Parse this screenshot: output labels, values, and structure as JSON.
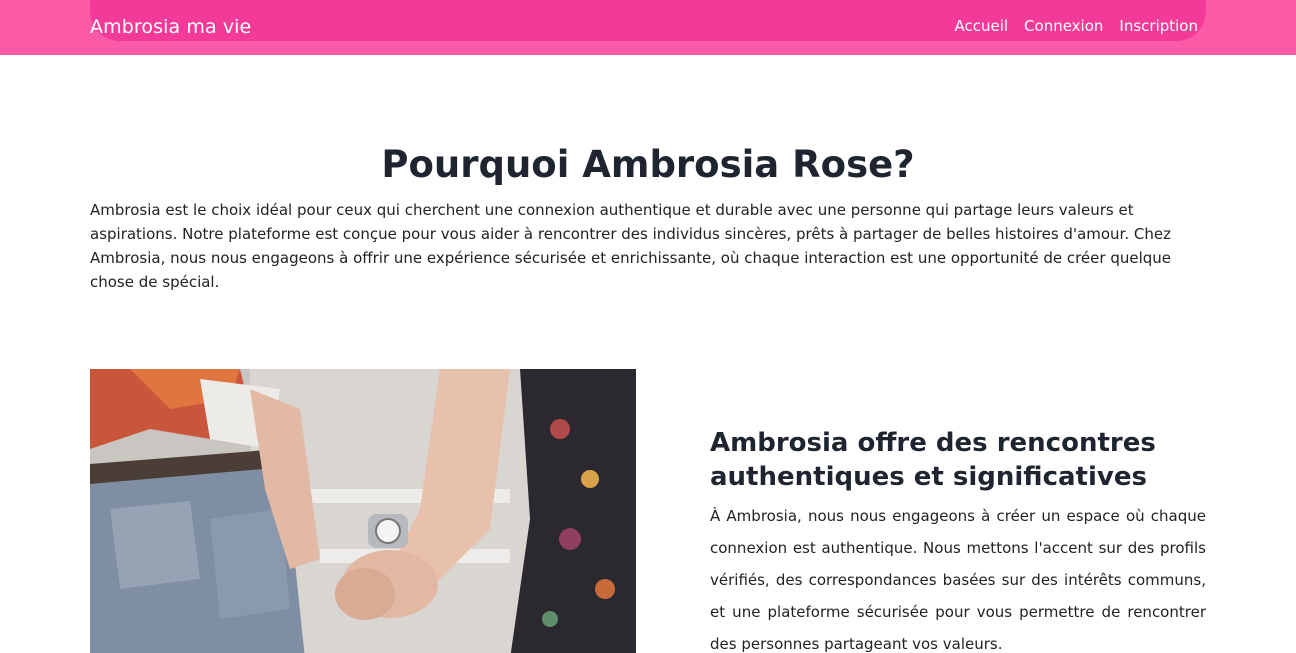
{
  "navbar": {
    "brand": "Ambrosia ma vie",
    "links": [
      "Accueil",
      "Connexion",
      "Inscription"
    ]
  },
  "why": {
    "title": "Pourquoi Ambrosia Rose?",
    "text": "Ambrosia est le choix idéal pour ceux qui cherchent une connexion authentique et durable avec une personne qui partage leurs valeurs et aspirations. Notre plateforme est conçue pour vous aider à rencontrer des individus sincères, prêts à partager de belles histoires d'amour. Chez Ambrosia, nous nous engageons à offrir une expérience sécurisée et enrichissante, où chaque interaction est une opportunité de créer quelque chose de spécial."
  },
  "feature": {
    "title": "Ambrosia offre des rencontres authentiques et significatives",
    "text": "À Ambrosia, nous nous engageons à créer un espace où chaque connexion est authentique. Nous mettons l'accent sur des profils vérifiés, des correspondances basées sur des intérêts communs, et une plateforme sécurisée pour vous permettre de rencontrer des personnes partageant vos valeurs."
  },
  "colors": {
    "navbar": "#fb5aa6",
    "navbar_inner": "#f33a98",
    "heading": "#1f2530"
  }
}
